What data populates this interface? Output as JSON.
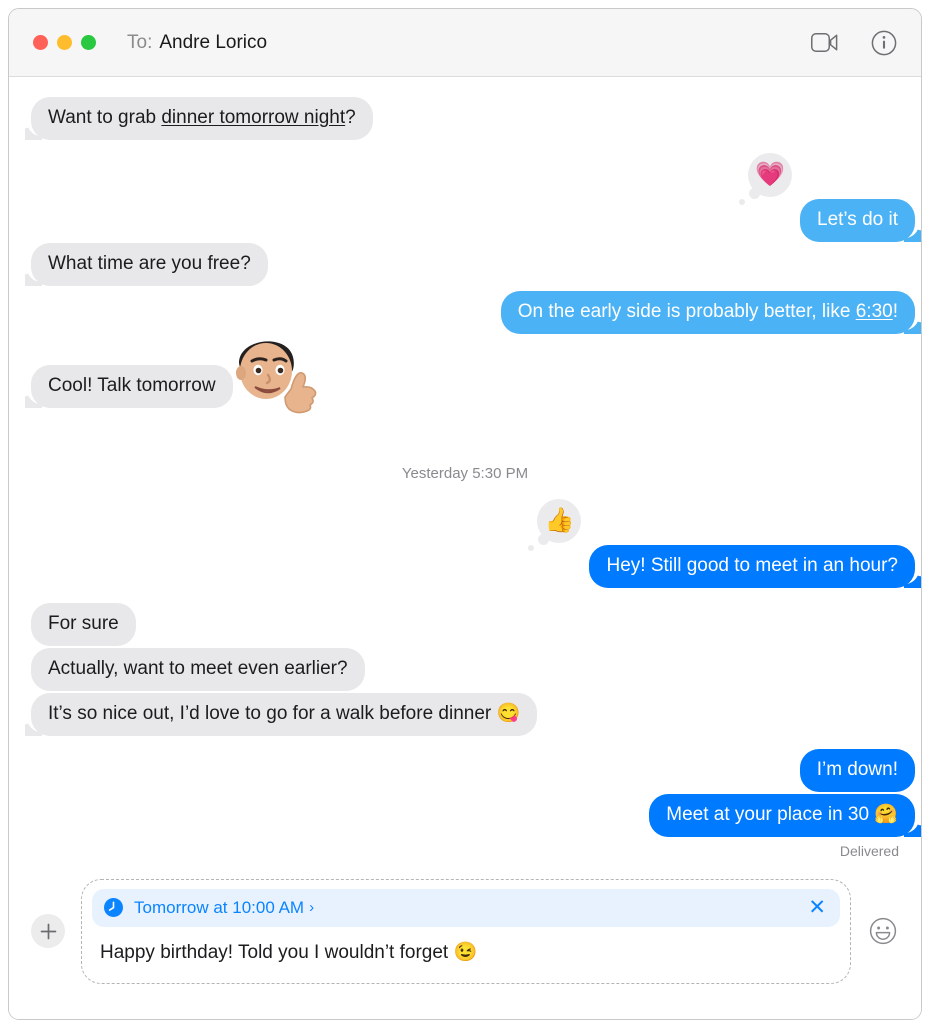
{
  "window": {
    "traffic_lights": [
      {
        "name": "close",
        "color": "#ff6159"
      },
      {
        "name": "minimize",
        "color": "#ffbd2e"
      },
      {
        "name": "zoom",
        "color": "#28c840"
      }
    ]
  },
  "header": {
    "to_label": "To:",
    "recipient": "Andre Lorico",
    "facetime_icon": "video-camera-icon",
    "details_icon": "info-circle-icon"
  },
  "conversation": {
    "timestamp_divider": "Yesterday 5:30 PM",
    "delivery_receipt": "Delivered",
    "messages": [
      {
        "id": "m1",
        "side": "received",
        "text_before": "Want to grab ",
        "link": "dinner tomorrow night",
        "text_after": "?",
        "full_text": "Want to grab dinner tomorrow night?"
      },
      {
        "id": "m2",
        "side": "sent",
        "full_text": "Let’s do it",
        "tapback": "💗",
        "tapback_name": "heart-tapback"
      },
      {
        "id": "m3",
        "side": "received",
        "full_text": "What time are you free?"
      },
      {
        "id": "m4",
        "side": "sent",
        "text_before": "On the early side is probably better, like ",
        "link": "6:30",
        "text_after": "!",
        "full_text": "On the early side is probably better, like 6:30!"
      },
      {
        "id": "m5",
        "side": "received",
        "full_text": "Cool! Talk tomorrow",
        "sticker": "👨",
        "sticker_name": "memoji-thumbs-up-sticker"
      },
      {
        "id": "m6",
        "side": "sent",
        "full_text": "Hey! Still good to meet in an hour?",
        "tapback": "👍",
        "tapback_name": "thumbs-up-tapback"
      },
      {
        "id": "m7",
        "side": "received",
        "full_text": "For sure"
      },
      {
        "id": "m8",
        "side": "received",
        "full_text": "Actually, want to meet even earlier?"
      },
      {
        "id": "m9",
        "side": "received",
        "full_text": "It’s so nice out, I’d love to go for a walk before dinner 😋"
      },
      {
        "id": "m10",
        "side": "sent",
        "full_text": "I’m down!"
      },
      {
        "id": "m11",
        "side": "sent",
        "full_text": "Meet at your place in 30 🤗"
      }
    ]
  },
  "composer": {
    "add_button_icon": "plus-icon",
    "schedule_chip": {
      "icon": "clock-icon",
      "label": "Tomorrow at 10:00 AM",
      "chevron": "›",
      "close_label": "✕"
    },
    "draft_text": "Happy birthday! Told you I wouldn’t forget 😉",
    "emoji_button_icon": "smiley-face-icon"
  },
  "colors": {
    "sent_bubble": "#007aff",
    "sent_bubble_light": "#4cb2f6",
    "received_bubble": "#e8e8ea",
    "accent_blue": "#0a84ff",
    "chip_background": "#e8f2fe",
    "titlebar": "#f6f6f6"
  }
}
